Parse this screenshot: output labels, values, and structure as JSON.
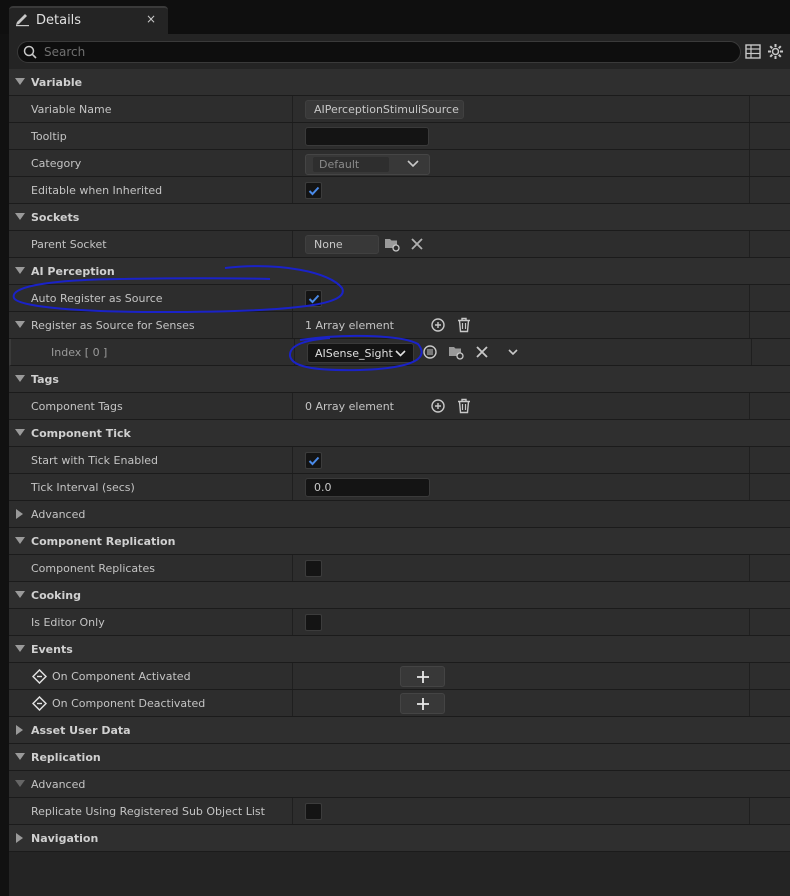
{
  "tab": {
    "title": "Details",
    "close": "×"
  },
  "search": {
    "placeholder": "Search"
  },
  "sections": {
    "variable": "Variable",
    "sockets": "Sockets",
    "ai_perception": "AI Perception",
    "tags": "Tags",
    "component_tick": "Component Tick",
    "component_replication": "Component Replication",
    "cooking": "Cooking",
    "events": "Events",
    "asset_user_data": "Asset User Data",
    "replication": "Replication",
    "navigation": "Navigation"
  },
  "props": {
    "variable_name": {
      "label": "Variable Name",
      "value": "AIPerceptionStimuliSource"
    },
    "tooltip": {
      "label": "Tooltip",
      "value": ""
    },
    "category": {
      "label": "Category",
      "value": "Default"
    },
    "editable_when_inherited": {
      "label": "Editable when Inherited",
      "checked": true
    },
    "parent_socket": {
      "label": "Parent Socket",
      "value": "None"
    },
    "auto_register": {
      "label": "Auto Register as Source",
      "checked": true
    },
    "register_senses": {
      "label": "Register as Source for Senses",
      "value": "1 Array element"
    },
    "index0": {
      "label": "Index [ 0 ]",
      "value": "AISense_Sight"
    },
    "component_tags": {
      "label": "Component Tags",
      "value": "0 Array element"
    },
    "start_with_tick": {
      "label": "Start with Tick Enabled",
      "checked": true
    },
    "tick_interval": {
      "label": "Tick Interval (secs)",
      "value": "0.0"
    },
    "advanced_tick": {
      "label": "Advanced"
    },
    "component_replicates": {
      "label": "Component Replicates",
      "checked": false
    },
    "is_editor_only": {
      "label": "Is Editor Only",
      "checked": false
    },
    "on_activated": {
      "label": "On Component Activated"
    },
    "on_deactivated": {
      "label": "On Component Deactivated"
    },
    "advanced_repl": {
      "label": "Advanced"
    },
    "replicate_subobject": {
      "label": "Replicate Using Registered Sub Object List",
      "checked": false
    }
  },
  "colors": {
    "panel": "#242424",
    "row": "#2d2d2d",
    "check": "#4a8ae8",
    "annotation": "#1a22c8"
  }
}
